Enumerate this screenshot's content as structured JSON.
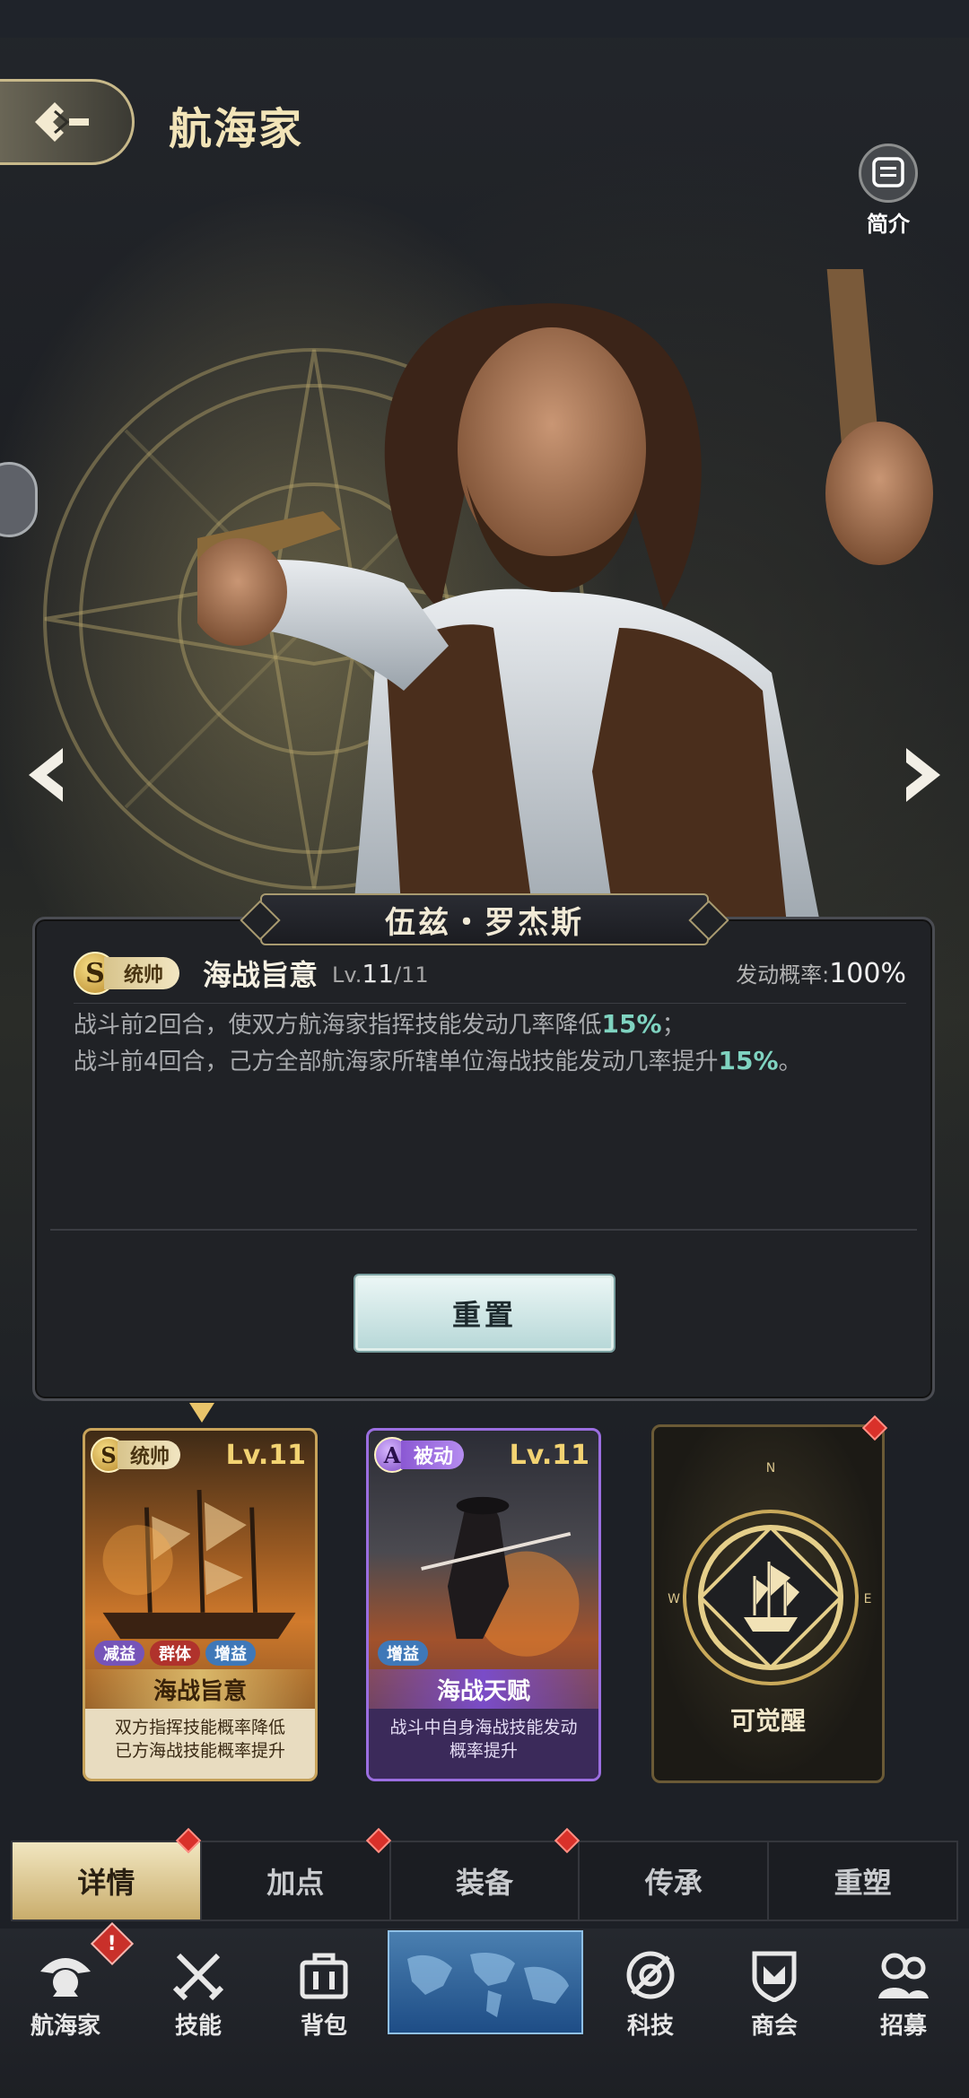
{
  "header": {
    "title": "航海家",
    "intro_label": "简介"
  },
  "hero": {
    "name": "伍兹・罗杰斯"
  },
  "skill_detail": {
    "grade": "S",
    "type": "统帅",
    "name": "海战旨意",
    "level_prefix": "Lv.",
    "level": "11",
    "level_max": "/11",
    "rate_label": "发动概率:",
    "rate_value": "100%",
    "desc_line1_a": "战斗前2回合，使双方航海家指挥技能发动几率降低",
    "desc_line1_hl": "15%",
    "desc_line1_b": "；",
    "desc_line2_a": "战斗前4回合，己方全部航海家所辖单位海战技能发动几率提升",
    "desc_line2_hl": "15%",
    "desc_line2_b": "。",
    "reset_label": "重置"
  },
  "cards": [
    {
      "grade": "S",
      "type": "统帅",
      "lv_prefix": "Lv.",
      "lv": "Lv.11",
      "tags": [
        "减益",
        "群体",
        "增益"
      ],
      "name": "海战旨意",
      "desc_line1": "双方指挥技能概率降低",
      "desc_line2": "已方海战技能概率提升"
    },
    {
      "grade": "A",
      "type": "被动",
      "lv_prefix": "Lv.",
      "lv": "Lv.11",
      "tags": [
        "增益"
      ],
      "name": "海战天赋",
      "desc_line1": "战斗中自身海战技能发动",
      "desc_line2": "概率提升"
    },
    {
      "compass": [
        "N",
        "E",
        "W"
      ],
      "awaken_label": "可觉醒"
    }
  ],
  "tabs": [
    {
      "label": "详情",
      "active": true,
      "dot": true
    },
    {
      "label": "加点",
      "dot": true
    },
    {
      "label": "装备",
      "dot": true
    },
    {
      "label": "传承"
    },
    {
      "label": "重塑"
    }
  ],
  "nav": [
    {
      "label": "航海家",
      "icon": "navigator-icon"
    },
    {
      "label": "技能",
      "icon": "crossed-swords-icon"
    },
    {
      "label": "背包",
      "icon": "backpack-icon"
    },
    {
      "label": "",
      "icon": "world-map-icon"
    },
    {
      "label": "科技",
      "icon": "tech-icon"
    },
    {
      "label": "商会",
      "icon": "guild-icon"
    },
    {
      "label": "招募",
      "icon": "recruit-icon"
    }
  ],
  "badges": {
    "alert": "!"
  },
  "colors": {
    "gold": "#e9c46a",
    "highlight": "#7fd3c0",
    "purple": "#9b6ee0",
    "red_dot": "#d9312a"
  }
}
